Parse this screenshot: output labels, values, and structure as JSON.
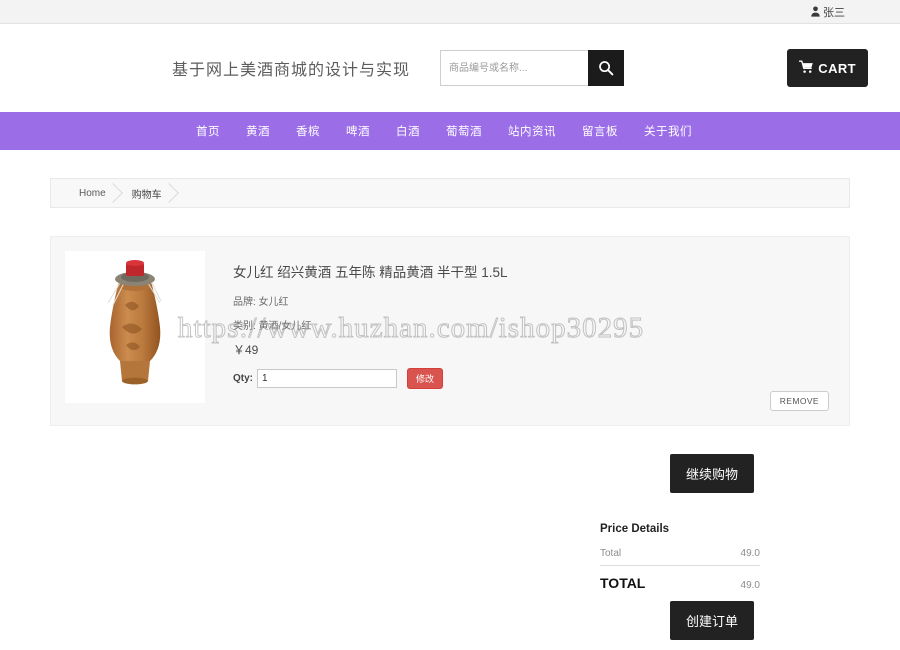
{
  "topbar": {
    "user_name": "张三",
    "user_icon": "user-icon"
  },
  "header": {
    "site_title": "基于网上美酒商城的设计与实现",
    "search": {
      "value": "",
      "placeholder": "商品编号或名称...",
      "icon": "search-icon"
    },
    "cart": {
      "label": "CART",
      "icon": "cart-icon"
    }
  },
  "nav": {
    "accent_color": "#9b6ee8",
    "items": [
      {
        "label": "首页"
      },
      {
        "label": "黄酒"
      },
      {
        "label": "香槟"
      },
      {
        "label": "啤酒"
      },
      {
        "label": "白酒"
      },
      {
        "label": "葡萄酒"
      },
      {
        "label": "站内资讯"
      },
      {
        "label": "留言板"
      },
      {
        "label": "关于我们"
      }
    ]
  },
  "breadcrumb": {
    "items": [
      {
        "label": "Home"
      },
      {
        "label": "购物车"
      }
    ]
  },
  "cart": {
    "item": {
      "title": "女儿红 绍兴黄酒 五年陈 精品黄酒 半干型 1.5L",
      "brand_label": "品牌: 女儿红",
      "category_label": "类别: 黄酒/女儿红",
      "price": "￥49",
      "qty_label": "Qty:",
      "qty_value": "1",
      "modify_label": "修改",
      "modify_color": "#d9534f",
      "remove_label": "REMOVE",
      "image_alt": "女儿红酒坛"
    },
    "continue_label": "继续购物",
    "create_order_label": "创建订单"
  },
  "price_details": {
    "heading": "Price Details",
    "rows": [
      {
        "label": "Total",
        "value": "49.0"
      }
    ],
    "total_label": "TOTAL",
    "total_value": "49.0"
  },
  "watermark": {
    "text": "https://www.huzhan.com/ishop30295"
  }
}
